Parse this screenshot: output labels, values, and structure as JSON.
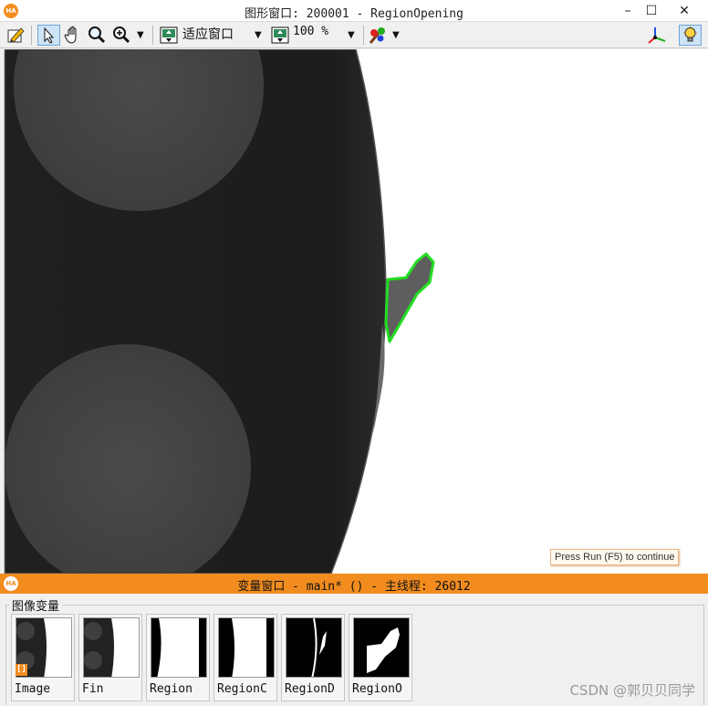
{
  "graphics_window": {
    "title": "图形窗口: 200001 - RegionOpening",
    "logo_text": "HA",
    "window_buttons": [
      "–",
      "☐",
      "✕"
    ]
  },
  "toolbar": {
    "fit_window_label": "适应窗口",
    "zoom_value": "100 %",
    "icons": [
      "edit-icon",
      "pointer-icon",
      "pan-hand-icon",
      "magnifier-icon",
      "zoom-in-icon",
      "fit-window-icon",
      "zoom-percent-icon",
      "color-palette-icon",
      "axes-icon",
      "lightbulb-icon"
    ]
  },
  "canvas": {
    "tooltip": "Press Run (F5) to continue",
    "region_outline_color": "#22dd22"
  },
  "variable_window": {
    "title": "变量窗口 - main* () - 主线程: 26012",
    "logo_text": "HA",
    "group_label": "图像变量",
    "active_marker": "[]",
    "thumbnails": [
      {
        "name": "Image",
        "kind": "gray"
      },
      {
        "name": "Fin",
        "kind": "gray"
      },
      {
        "name": "Region",
        "kind": "binary"
      },
      {
        "name": "RegionC",
        "kind": "binary"
      },
      {
        "name": "RegionD",
        "kind": "binary-inverted"
      },
      {
        "name": "RegionO",
        "kind": "blob"
      }
    ]
  },
  "watermark": "CSDN @郭贝贝同学",
  "colors": {
    "accent_orange": "#f28c1f",
    "toolbar_bg": "#f0f0f0",
    "region_green": "#22dd22"
  }
}
